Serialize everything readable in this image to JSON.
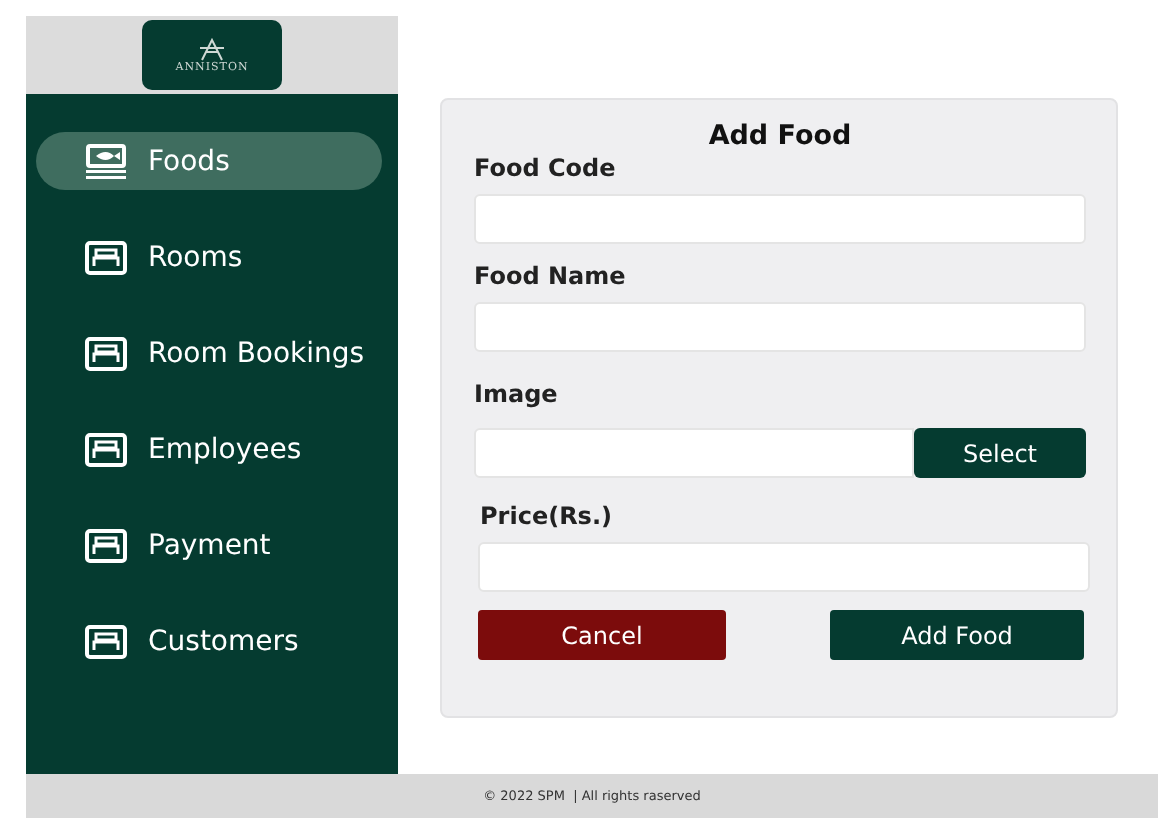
{
  "logo": {
    "text": "ANNISTON"
  },
  "sidebar": {
    "items": [
      {
        "label": "Foods",
        "kind": "food",
        "selected": true
      },
      {
        "label": "Rooms",
        "kind": "bed",
        "selected": false
      },
      {
        "label": "Room Bookings",
        "kind": "bed",
        "selected": false
      },
      {
        "label": "Employees",
        "kind": "bed",
        "selected": false
      },
      {
        "label": "Payment",
        "kind": "bed",
        "selected": false
      },
      {
        "label": "Customers",
        "kind": "bed",
        "selected": false
      }
    ]
  },
  "form": {
    "title": "Add Food",
    "fields": [
      {
        "label": "Food Code",
        "kind": "text"
      },
      {
        "label": "Food Name",
        "kind": "text"
      },
      {
        "label": "Image",
        "kind": "file",
        "button": "Select"
      },
      {
        "label": "Price(Rs.)",
        "kind": "text"
      }
    ],
    "buttons": [
      {
        "label": "Cancel",
        "kind": "cancel"
      },
      {
        "label": "Add Food",
        "kind": "submit"
      }
    ]
  },
  "footer": {
    "text": "© 2022 SPM  | All rights raserved"
  }
}
